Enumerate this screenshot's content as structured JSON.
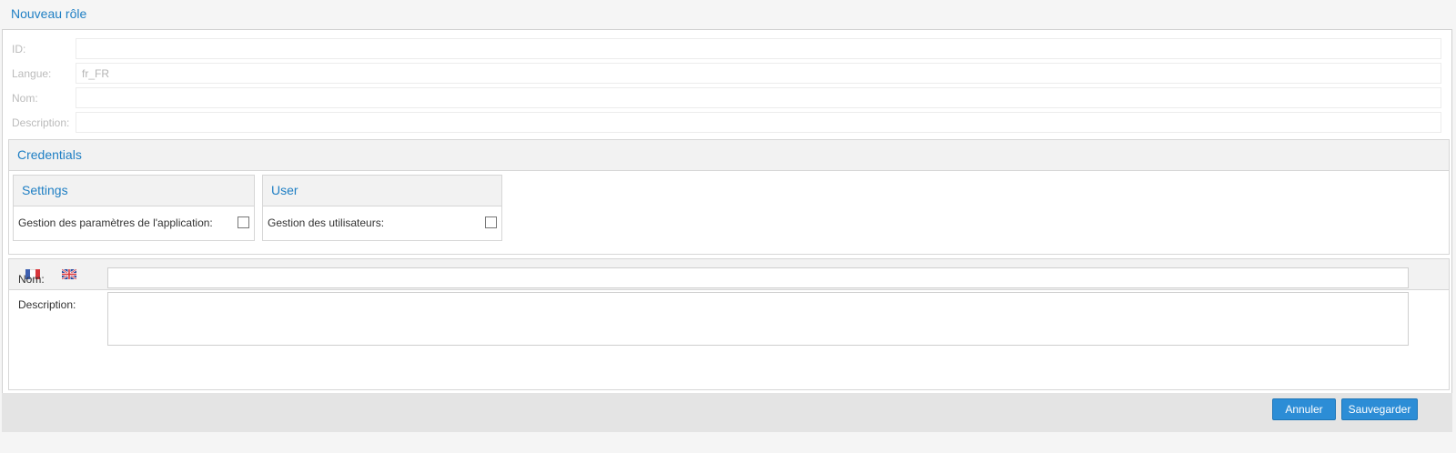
{
  "window": {
    "title": "Nouveau rôle"
  },
  "form": {
    "id": {
      "label": "ID:",
      "value": ""
    },
    "langue": {
      "label": "Langue:",
      "value": "fr_FR"
    },
    "nom": {
      "label": "Nom:",
      "value": ""
    },
    "description": {
      "label": "Description:",
      "value": ""
    }
  },
  "credentials": {
    "title": "Credentials",
    "groups": [
      {
        "title": "Settings",
        "items": [
          {
            "label": "Gestion des paramètres de l'application:",
            "checked": false
          }
        ]
      },
      {
        "title": "User",
        "items": [
          {
            "label": "Gestion des utilisateurs:",
            "checked": false
          }
        ]
      }
    ]
  },
  "translations": {
    "tabs": [
      {
        "icon": "flag-fr-icon",
        "active": true
      },
      {
        "icon": "flag-gb-icon",
        "active": false
      }
    ],
    "nom_label": "Nom:",
    "description_label": "Description:"
  },
  "footer": {
    "cancel_label": "Annuler",
    "save_label": "Sauvegarder"
  },
  "colors": {
    "accent": "#1f7fc4",
    "button": "#2c8dd6"
  }
}
